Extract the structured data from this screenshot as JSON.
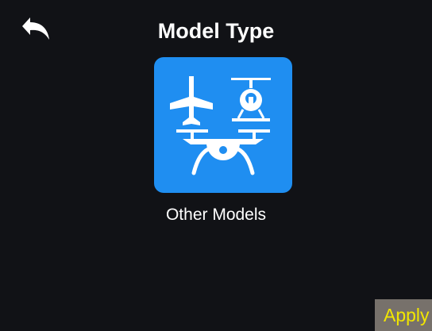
{
  "header": {
    "title": "Model Type",
    "back_icon": "back-arrow-icon"
  },
  "selection": {
    "label": "Other Models",
    "icon": "other-models-icon",
    "icon_parts": [
      "airplane-icon",
      "helicopter-icon",
      "drone-icon"
    ]
  },
  "footer": {
    "apply_label": "Apply"
  },
  "colors": {
    "background": "#111216",
    "tile": "#1f8ef1",
    "text": "#ffffff",
    "apply_background": "#77716b",
    "apply_text": "#f2e600"
  }
}
